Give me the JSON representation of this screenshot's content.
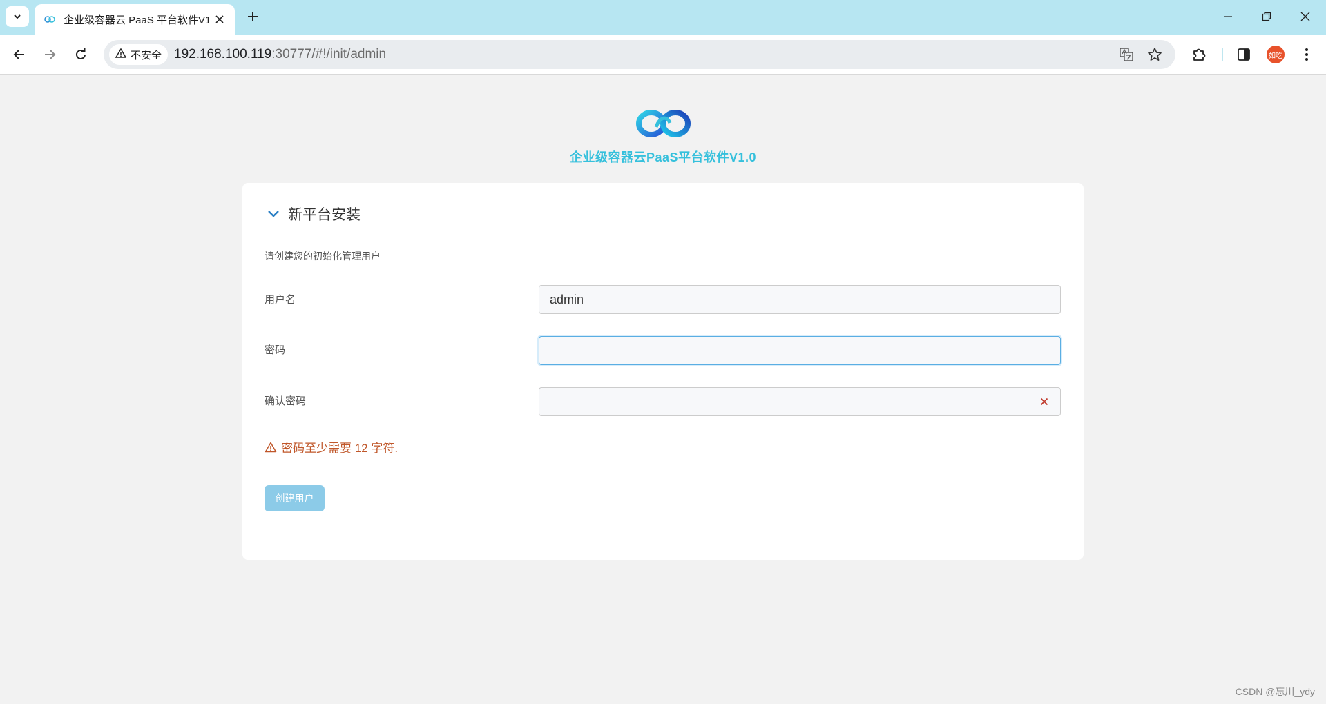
{
  "browser": {
    "tab_title": "企业级容器云 PaaS 平台软件V1",
    "url_host": "192.168.100.119",
    "url_path": ":30777/#!/init/admin",
    "security_label": "不安全",
    "profile_label": "如吃"
  },
  "brand": {
    "title": "企业级容器云PaaS平台软件V1.0",
    "accent_color": "#35c0dc"
  },
  "form": {
    "section_title": "新平台安装",
    "intro": "请创建您的初始化管理用户",
    "username_label": "用户名",
    "username_value": "admin",
    "password_label": "密码",
    "password_value": "",
    "confirm_label": "确认密码",
    "confirm_value": "",
    "error_message": "密码至少需要 12 字符.",
    "submit_label": "创建用户"
  },
  "icons": {
    "tab_search": "chevron-down-icon",
    "close_tab": "close-icon",
    "new_tab": "plus-icon",
    "back": "arrow-left-icon",
    "forward": "arrow-right-icon",
    "reload": "reload-icon",
    "warning": "warning-triangle-icon",
    "translate": "translate-icon",
    "bookmark": "star-icon",
    "extensions": "puzzle-icon",
    "side_panel": "side-panel-icon",
    "menu": "kebab-menu-icon",
    "clear": "clear-x-icon"
  },
  "footer": {
    "watermark": "CSDN @忘川_ydy"
  }
}
